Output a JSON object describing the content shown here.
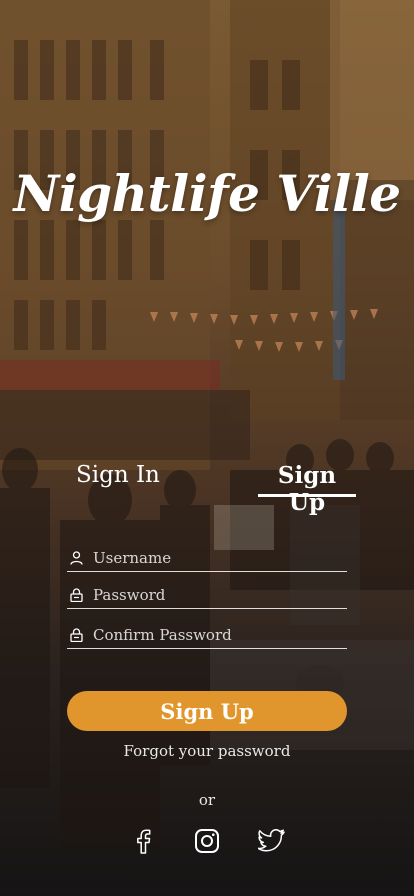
{
  "app": {
    "title": "Nightlife Ville"
  },
  "tabs": {
    "sign_in": "Sign In",
    "sign_up": "Sign Up",
    "active": "sign_up"
  },
  "form": {
    "username_placeholder": "Username",
    "password_placeholder": "Password",
    "confirm_password_placeholder": "Confirm Password"
  },
  "actions": {
    "sign_up_button": "Sign Up",
    "forgot_password": "Forgot your password",
    "or": "or"
  },
  "social": [
    "facebook-icon",
    "instagram-icon",
    "twitter-icon"
  ],
  "colors": {
    "accent": "#e0962c",
    "text": "#ffffff"
  }
}
